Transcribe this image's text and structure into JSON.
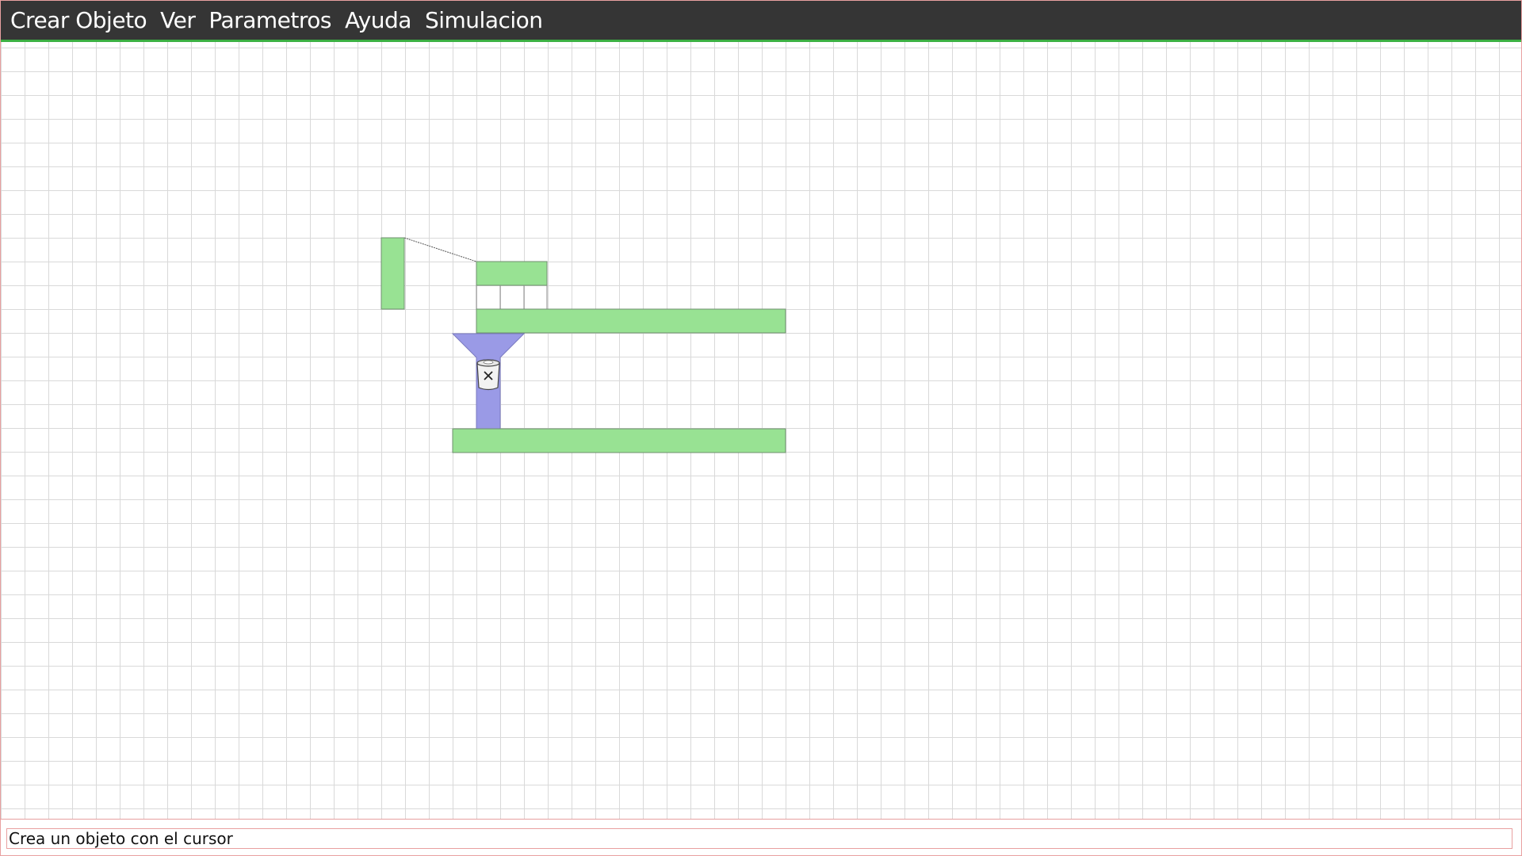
{
  "menu": {
    "items": [
      {
        "label": "Crear Objeto"
      },
      {
        "label": "Ver"
      },
      {
        "label": "Parametros"
      },
      {
        "label": "Ayuda"
      },
      {
        "label": "Simulacion"
      }
    ]
  },
  "canvas": {
    "grid": true,
    "colors": {
      "static_body": "#98e293",
      "dynamic_body": "#9a9ae6",
      "outline": "#6f8f6f",
      "grid_line": "#d9d9d9"
    },
    "objects": [
      {
        "kind": "static-block"
      },
      {
        "kind": "static-block"
      },
      {
        "kind": "static-block"
      },
      {
        "kind": "static-block"
      },
      {
        "kind": "funnel-body"
      },
      {
        "kind": "rope"
      }
    ],
    "cursor_icon": "trash-delete-icon"
  },
  "status": {
    "message": "Crea un objeto con el cursor"
  }
}
